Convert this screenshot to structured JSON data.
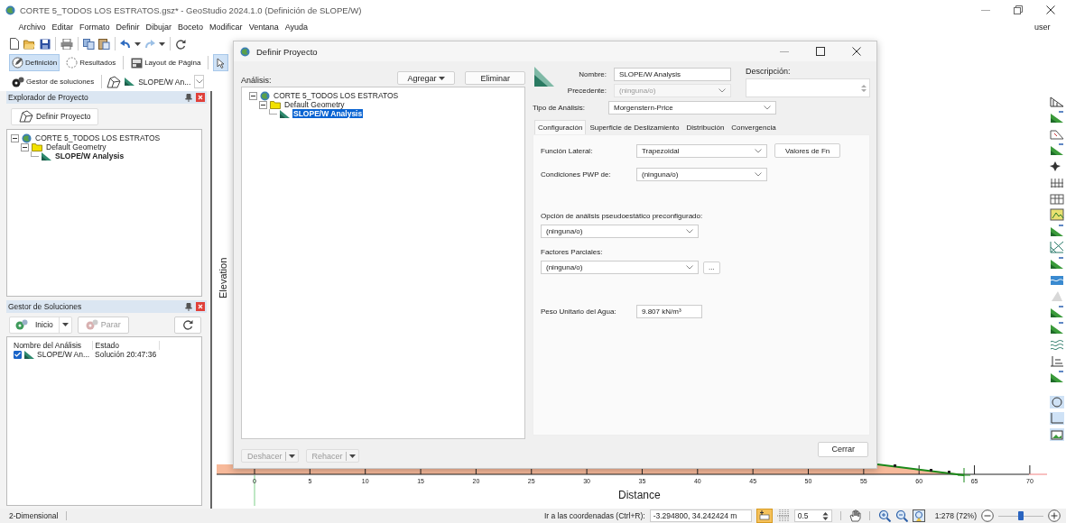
{
  "window": {
    "title": "CORTE 5_TODOS LOS ESTRATOS.gsz* - GeoStudio 2024.1.0 (Definición de SLOPE/W)"
  },
  "menu": [
    "Archivo",
    "Editar",
    "Formato",
    "Definir",
    "Dibujar",
    "Boceto",
    "Modificar",
    "Ventana",
    "Ayuda"
  ],
  "user": "user",
  "mode_tabs": [
    {
      "label": "Definición",
      "selected": true
    },
    {
      "label": "Resultados",
      "selected": false
    },
    {
      "label": "Layout de Página",
      "selected": false
    }
  ],
  "pointer_tool": {
    "selected": true
  },
  "solver_toolbar": {
    "manager": "Gestor de soluciones",
    "analysis": "SLOPE/W An..."
  },
  "explorer": {
    "title": "Explorador de Proyecto",
    "button": "Definir Proyecto",
    "tree": [
      {
        "label": "CORTE 5_TODOS LOS ESTRATOS",
        "kind": "project",
        "expanded": true,
        "selected": false,
        "children": [
          {
            "label": "Default Geometry",
            "kind": "geometry",
            "expanded": true,
            "selected": false,
            "children": [
              {
                "label": "SLOPE/W Analysis",
                "kind": "analysis",
                "selected": true
              }
            ]
          }
        ]
      }
    ]
  },
  "solutions": {
    "title": "Gestor de Soluciones",
    "start": {
      "label": "Inicio",
      "disabled": false
    },
    "stop": {
      "label": "Parar",
      "disabled": true
    },
    "columns": [
      "Nombre del Análisis",
      "Estado"
    ],
    "rows": [
      {
        "checked": true,
        "name": "SLOPE/W An...",
        "status": "Solución 20:47:36"
      }
    ]
  },
  "canvas": {
    "y_axis_label": "Elevation",
    "x_axis_label": "Distance",
    "x_ticks": [
      "0",
      "5",
      "10",
      "15",
      "20",
      "25",
      "30",
      "35",
      "40",
      "45",
      "50",
      "55",
      "60",
      "65",
      "70"
    ]
  },
  "dialog": {
    "title": "Definir Proyecto",
    "analysis_label": "Análisis:",
    "add_button": "Agregar",
    "delete_button": "Eliminar",
    "tree": [
      {
        "label": "CORTE 5_TODOS LOS ESTRATOS",
        "kind": "project",
        "expanded": true,
        "selected": false,
        "children": [
          {
            "label": "Default Geometry",
            "kind": "geometry",
            "expanded": true,
            "selected": false,
            "children": [
              {
                "label": "SLOPE/W Analysis",
                "kind": "analysis",
                "selected": true
              }
            ]
          }
        ]
      }
    ],
    "undo": {
      "label": "Deshacer",
      "disabled": true
    },
    "redo": {
      "label": "Rehacer",
      "disabled": true
    },
    "name_label": "Nombre:",
    "name": "SLOPE/W Analysis",
    "parent_label": "Precedente:",
    "parent": {
      "value": "(ninguna/o)",
      "disabled": true
    },
    "description_label": "Descripción:",
    "type_label": "Tipo de Análisis:",
    "type": "Morgenstern-Price",
    "tabs": [
      {
        "label": "Configuración",
        "selected": true
      },
      {
        "label": "Superficie de Deslizamiento",
        "selected": false
      },
      {
        "label": "Distribución",
        "selected": false
      },
      {
        "label": "Convergencia",
        "selected": false
      }
    ],
    "fields": [
      {
        "kind": "select",
        "label": "Función Lateral:",
        "value": "Trapezoidal",
        "button": "Valores de Fn"
      },
      {
        "kind": "select",
        "label": "Condiciones PWP de:",
        "value": "(ninguna/o)"
      },
      {
        "kind": "select_below",
        "label": "Opción de análisis pseudoestático preconfigurado:",
        "value": "(ninguna/o)"
      },
      {
        "kind": "select_below",
        "label": "Factores Parciales:",
        "value": "(ninguna/o)",
        "button": "..."
      },
      {
        "kind": "input",
        "label": "Peso Unitario del Agua:",
        "value": "9.807 kN/m³"
      }
    ],
    "close_button": "Cerrar"
  },
  "status_bar": {
    "mode": "2-Dimensional",
    "goto_label": "Ir a las coordenadas (Ctrl+R):",
    "coordinates": "-3.294800, 34.242424 m",
    "snap_on": true,
    "grid_spacing": "0.5",
    "zoom": "1:278 (72%)",
    "zoom_slider": {
      "level": 0.5
    }
  }
}
